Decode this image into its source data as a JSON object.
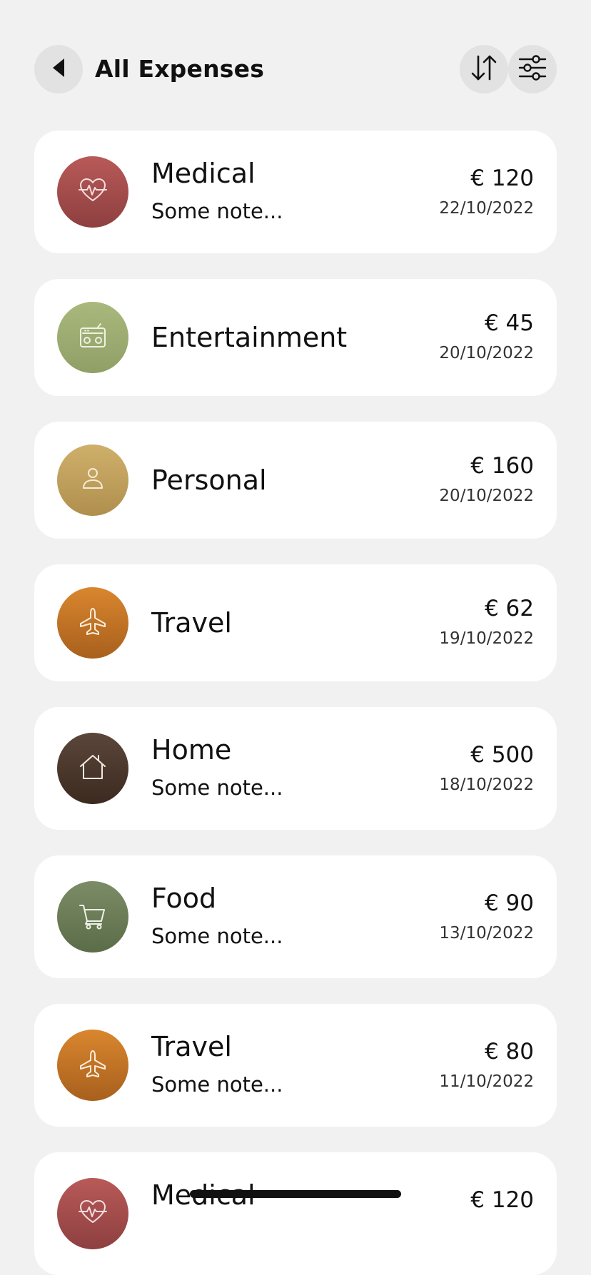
{
  "header": {
    "title": "All Expenses"
  },
  "expenses": [
    {
      "category": "Medical",
      "note": "Some note...",
      "amount": "€ 120",
      "date": "22/10/2022",
      "icon": "heartbeat-icon"
    },
    {
      "category": "Entertainment",
      "note": "",
      "amount": "€ 45",
      "date": "20/10/2022",
      "icon": "radio-icon"
    },
    {
      "category": "Personal",
      "note": "",
      "amount": "€ 160",
      "date": "20/10/2022",
      "icon": "person-icon"
    },
    {
      "category": "Travel",
      "note": "",
      "amount": "€ 62",
      "date": "19/10/2022",
      "icon": "airplane-icon"
    },
    {
      "category": "Home",
      "note": "Some note...",
      "amount": "€ 500",
      "date": "18/10/2022",
      "icon": "house-icon"
    },
    {
      "category": "Food",
      "note": "Some note...",
      "amount": "€ 90",
      "date": "13/10/2022",
      "icon": "cart-icon"
    },
    {
      "category": "Travel",
      "note": "Some note...",
      "amount": "€ 80",
      "date": "11/10/2022",
      "icon": "airplane-icon"
    },
    {
      "category": "Medical",
      "note": "",
      "amount": "€ 120",
      "date": "",
      "icon": "heartbeat-icon"
    }
  ],
  "colors": {
    "background": "#f1f1f1",
    "card": "#ffffff",
    "medical": "#a34c4c",
    "entertainment": "#9dac72",
    "personal": "#c0a05c",
    "travel": "#c27528",
    "home": "#4b372c",
    "food": "#6b7c57"
  }
}
